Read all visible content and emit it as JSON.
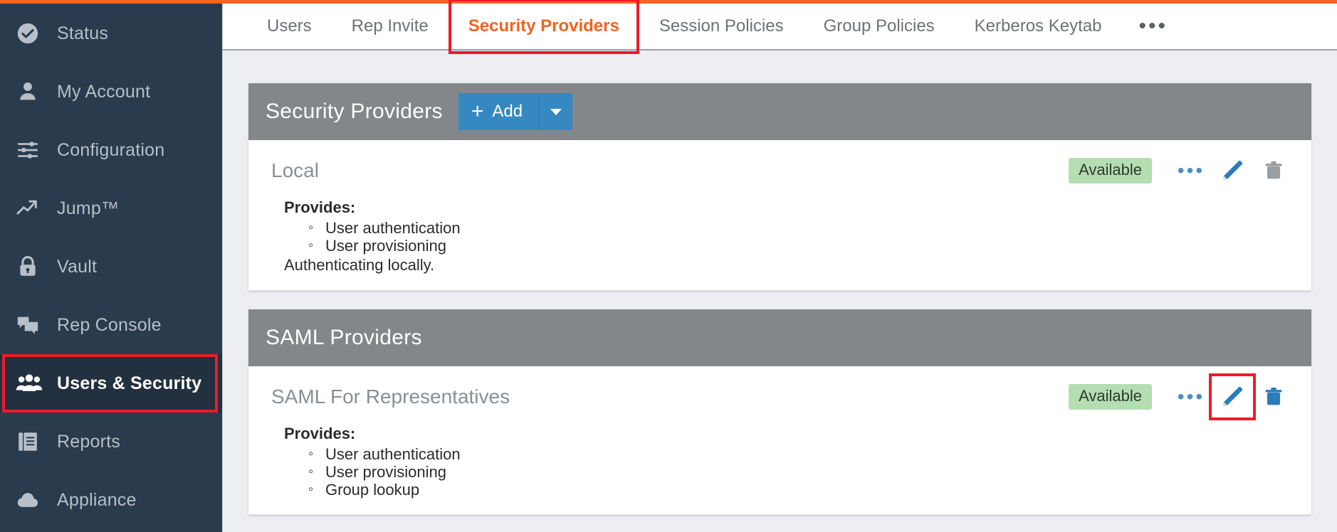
{
  "theme": {
    "accent_orange": "#f26522",
    "sidebar_bg": "#2a3b4d",
    "highlight_red": "#ee1c25",
    "panel_header_gray": "#83878a",
    "button_blue": "#3688c0",
    "badge_green": "#b4ddb1",
    "icon_blue": "#2b7cb9"
  },
  "sidebar": {
    "items": [
      {
        "label": "Status",
        "icon": "check-circle-icon",
        "active": false
      },
      {
        "label": "My Account",
        "icon": "person-icon",
        "active": false
      },
      {
        "label": "Configuration",
        "icon": "sliders-icon",
        "active": false
      },
      {
        "label": "Jump™",
        "icon": "trend-arrow-icon",
        "active": false
      },
      {
        "label": "Vault",
        "icon": "lock-icon",
        "active": false
      },
      {
        "label": "Rep Console",
        "icon": "chat-bubbles-icon",
        "active": false
      },
      {
        "label": "Users & Security",
        "icon": "users-group-icon",
        "active": true
      },
      {
        "label": "Reports",
        "icon": "report-doc-icon",
        "active": false
      },
      {
        "label": "Appliance",
        "icon": "cloud-icon",
        "active": false
      }
    ]
  },
  "tabs": {
    "items": [
      {
        "label": "Users",
        "selected": false
      },
      {
        "label": "Rep Invite",
        "selected": false
      },
      {
        "label": "Security Providers",
        "selected": true
      },
      {
        "label": "Session Policies",
        "selected": false
      },
      {
        "label": "Group Policies",
        "selected": false
      },
      {
        "label": "Kerberos Keytab",
        "selected": false
      }
    ],
    "overflow": "•••"
  },
  "panels": [
    {
      "title": "Security Providers",
      "has_add_button": true,
      "add_label": "Add",
      "add_plus": "+",
      "providers": [
        {
          "name": "Local",
          "status": "Available",
          "provides_label": "Provides:",
          "provides": [
            "User authentication",
            "User provisioning"
          ],
          "note": "Authenticating locally.",
          "edit_highlighted": false,
          "delete_color": "#9a9fa4"
        }
      ]
    },
    {
      "title": "SAML Providers",
      "has_add_button": false,
      "add_label": "",
      "add_plus": "",
      "providers": [
        {
          "name": "SAML For Representatives",
          "status": "Available",
          "provides_label": "Provides:",
          "provides": [
            "User authentication",
            "User provisioning",
            "Group lookup"
          ],
          "note": "",
          "edit_highlighted": true,
          "delete_color": "#2b7cb9"
        }
      ]
    }
  ],
  "icon_names": {
    "more": "more-horizontal-icon",
    "edit": "pencil-edit-icon",
    "delete": "trash-delete-icon",
    "add": "plus-icon",
    "caret": "chevron-down-icon"
  }
}
